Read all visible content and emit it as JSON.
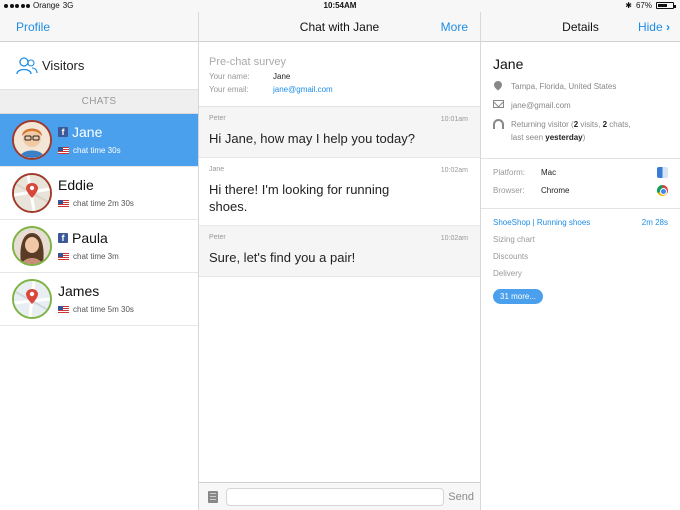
{
  "status_bar": {
    "carrier": "Orange",
    "network": "3G",
    "time": "10:54AM",
    "battery": "67%",
    "battery_fraction": 0.67
  },
  "left_pane": {
    "profile_label": "Profile",
    "visitors_label": "Visitors",
    "chats_header": "CHATS",
    "visitors": [
      {
        "name": "Jane",
        "chat_time": "chat time 30s",
        "facebook": true,
        "selected": true
      },
      {
        "name": "Eddie",
        "chat_time": "chat time 2m 30s",
        "facebook": false,
        "selected": false
      },
      {
        "name": "Paula",
        "chat_time": "chat time 3m",
        "facebook": true,
        "selected": false
      },
      {
        "name": "James",
        "chat_time": "chat time 5m 30s",
        "facebook": false,
        "selected": false
      }
    ]
  },
  "center_pane": {
    "title": "Chat with Jane",
    "more_label": "More",
    "survey": {
      "title": "Pre-chat survey",
      "name_label": "Your name:",
      "name_value": "Jane",
      "email_label": "Your email:",
      "email_value": "jane@gmail.com"
    },
    "messages": [
      {
        "sender": "Peter",
        "time": "10:01am",
        "text": "Hi Jane, how may I help you today?"
      },
      {
        "sender": "Jane",
        "time": "10:02am",
        "text": "Hi there! I'm looking for running shoes."
      },
      {
        "sender": "Peter",
        "time": "10:02am",
        "text": "Sure, let's find you a pair!"
      }
    ],
    "input_placeholder": "",
    "send_label": "Send"
  },
  "right_pane": {
    "title": "Details",
    "hide_label": "Hide",
    "name": "Jane",
    "location": "Tampa, Florida, United States",
    "email": "jane@gmail.com",
    "visitor_prefix": "Returning visitor (",
    "visits_count": "2",
    "visits_mid": " visits, ",
    "chats_count": "2",
    "chats_suffix": " chats,",
    "last_seen_prefix": "last seen ",
    "last_seen": "yesterday",
    "last_seen_suffix": ")",
    "platform_label": "Platform:",
    "platform_value": "Mac",
    "browser_label": "Browser:",
    "browser_value": "Chrome",
    "page_site": "ShoeShop",
    "page_sep": " | ",
    "page_current": "Running shoes",
    "page_duration": "2m 28s",
    "history": [
      "Sizing chart",
      "Discounts",
      "Delivery"
    ],
    "more_pages": "31 more..."
  },
  "colors": {
    "accent": "#1e8de6",
    "selected_row": "#4aa0ec"
  }
}
